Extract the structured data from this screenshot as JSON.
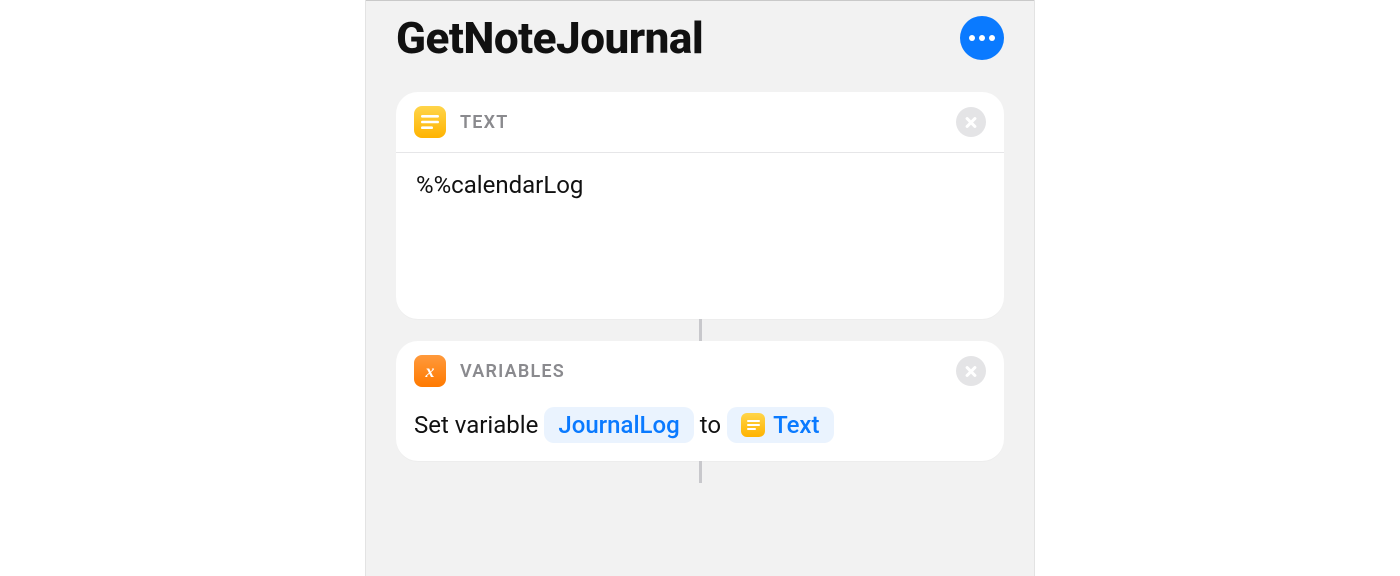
{
  "header": {
    "title": "GetNoteJournal"
  },
  "cards": {
    "text": {
      "group": "TEXT",
      "content": "%%calendarLog"
    },
    "variables": {
      "group": "VARIABLES",
      "prefix": "Set variable",
      "variable_name": "JournalLog",
      "middle": "to",
      "value_label": "Text"
    }
  }
}
